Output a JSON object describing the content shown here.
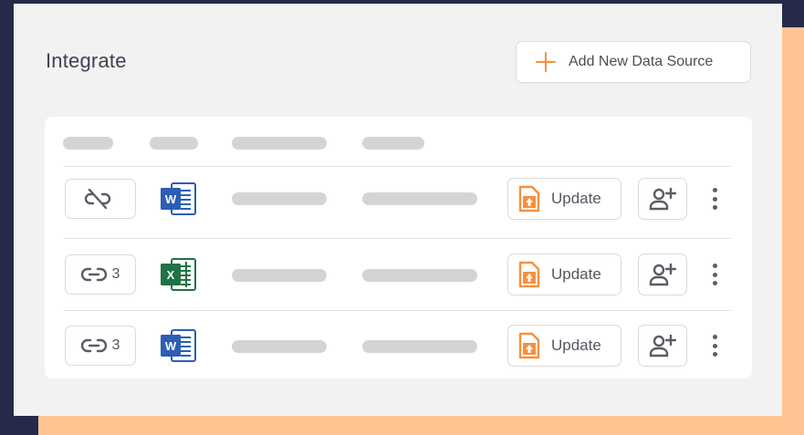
{
  "header": {
    "title": "Integrate",
    "add_button_label": "Add New Data Source",
    "add_icon": "plus-icon"
  },
  "colors": {
    "page_background": "#252a4b",
    "accent_background": "#fec593",
    "panel_background": "#f2f2f2",
    "accent": "#f7903b",
    "word_blue": "#2b5eb4",
    "excel_green": "#207245",
    "placeholder_grey": "#d4d4d4"
  },
  "table": {
    "rows": [
      {
        "link_icon": "unlink-icon",
        "link_count": "",
        "file_type": "word",
        "file_icon": "word-file-icon",
        "update_label": "Update",
        "update_icon": "file-upload-icon",
        "share_icon": "add-user-icon",
        "more_icon": "more-vertical-icon"
      },
      {
        "link_icon": "link-icon",
        "link_count": "3",
        "file_type": "excel",
        "file_icon": "excel-file-icon",
        "update_label": "Update",
        "update_icon": "file-upload-icon",
        "share_icon": "add-user-icon",
        "more_icon": "more-vertical-icon"
      },
      {
        "link_icon": "link-icon",
        "link_count": "3",
        "file_type": "word",
        "file_icon": "word-file-icon",
        "update_label": "Update",
        "update_icon": "file-upload-icon",
        "share_icon": "add-user-icon",
        "more_icon": "more-vertical-icon"
      }
    ]
  }
}
